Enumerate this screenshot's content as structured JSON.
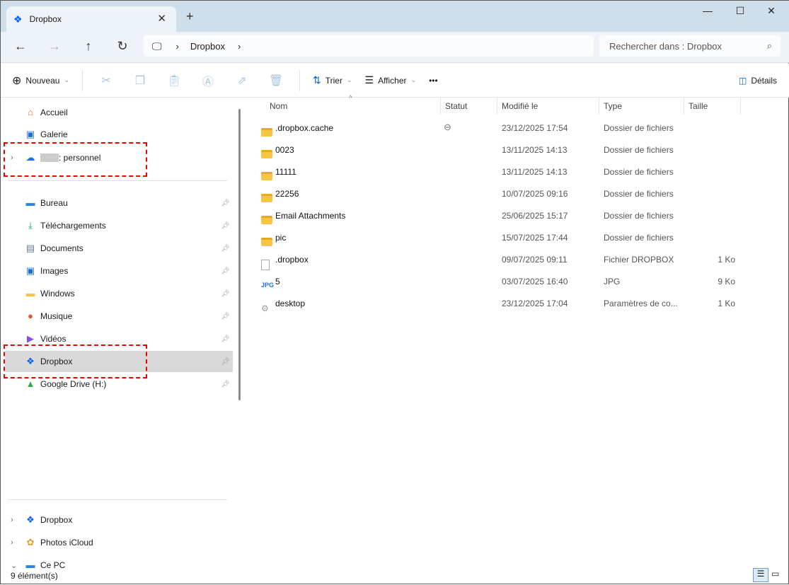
{
  "window": {
    "tab_title": "Dropbox",
    "new_tab": "+",
    "close_tab": "✕",
    "minimize": "—",
    "maximize": "☐",
    "close": "✕"
  },
  "nav": {
    "back": "←",
    "forward": "→",
    "up": "↑",
    "refresh": "↻",
    "breadcrumb": [
      "Dropbox"
    ],
    "search_placeholder": "Rechercher dans : Dropbox"
  },
  "toolbar": {
    "new": "Nouveau",
    "sort": "Trier",
    "view": "Afficher",
    "more": "•••",
    "details": "Détails"
  },
  "sidebar": {
    "top": [
      {
        "label": "Accueil"
      },
      {
        "label": "Galerie"
      },
      {
        "label": ": personnel"
      }
    ],
    "pinned": [
      {
        "label": "Bureau"
      },
      {
        "label": "Téléchargements"
      },
      {
        "label": "Documents"
      },
      {
        "label": "Images"
      },
      {
        "label": "Windows"
      },
      {
        "label": "Musique"
      },
      {
        "label": "Vidéos"
      },
      {
        "label": "Dropbox"
      },
      {
        "label": "Google Drive (H:)"
      }
    ],
    "bottom": [
      {
        "label": "Dropbox"
      },
      {
        "label": "Photos iCloud"
      },
      {
        "label": "Ce PC"
      }
    ]
  },
  "columns": [
    "Nom",
    "Statut",
    "Modifié le",
    "Type",
    "Taille"
  ],
  "files": [
    {
      "name": ".dropbox.cache",
      "status": "⊖",
      "modified": "23/12/2025 17:54",
      "type": "Dossier de fichiers",
      "size": "",
      "kind": "folder"
    },
    {
      "name": "0023",
      "status": "",
      "modified": "13/11/2025 14:13",
      "type": "Dossier de fichiers",
      "size": "",
      "kind": "folder"
    },
    {
      "name": "11111",
      "status": "",
      "modified": "13/11/2025 14:13",
      "type": "Dossier de fichiers",
      "size": "",
      "kind": "folder"
    },
    {
      "name": "22256",
      "status": "",
      "modified": "10/07/2025 09:16",
      "type": "Dossier de fichiers",
      "size": "",
      "kind": "folder"
    },
    {
      "name": "Email Attachments",
      "status": "",
      "modified": "25/06/2025 15:17",
      "type": "Dossier de fichiers",
      "size": "",
      "kind": "folder"
    },
    {
      "name": "pic",
      "status": "",
      "modified": "15/07/2025 17:44",
      "type": "Dossier de fichiers",
      "size": "",
      "kind": "folder"
    },
    {
      "name": ".dropbox",
      "status": "",
      "modified": "09/07/2025 09:11",
      "type": "Fichier DROPBOX",
      "size": "1 Ko",
      "kind": "file"
    },
    {
      "name": "5",
      "status": "",
      "modified": "03/07/2025 16:40",
      "type": "JPG",
      "size": "9 Ko",
      "kind": "jpg"
    },
    {
      "name": "desktop",
      "status": "",
      "modified": "23/12/2025 17:04",
      "type": "Paramètres de co...",
      "size": "1 Ko",
      "kind": "ini"
    }
  ],
  "status": {
    "count": "9 élément(s)"
  }
}
